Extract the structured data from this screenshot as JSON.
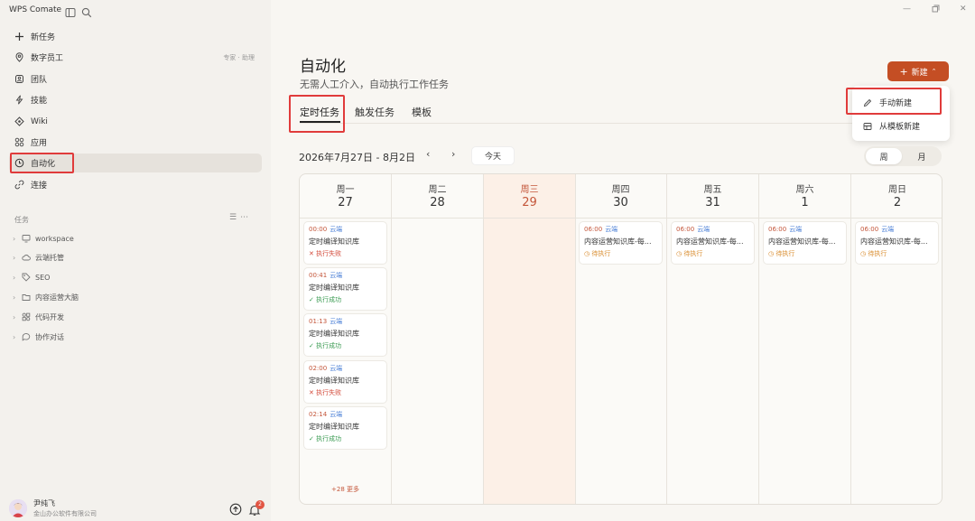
{
  "app": {
    "title": "WPS Comate"
  },
  "sidebar": {
    "nav": [
      {
        "label": "新任务",
        "icon": "plus-icon"
      },
      {
        "label": "数字员工",
        "icon": "location-pin-icon",
        "extra": "专家 · 助理"
      },
      {
        "label": "团队",
        "icon": "team-icon"
      },
      {
        "label": "技能",
        "icon": "bolt-icon"
      },
      {
        "label": "Wiki",
        "icon": "wiki-icon"
      },
      {
        "label": "应用",
        "icon": "apps-grid-icon"
      },
      {
        "label": "自动化",
        "icon": "clock-icon",
        "active": true
      },
      {
        "label": "连接",
        "icon": "link-icon"
      }
    ],
    "section_label": "任务",
    "tree": [
      {
        "label": "workspace",
        "icon": "monitor-icon"
      },
      {
        "label": "云端托管",
        "icon": "cloud-icon"
      },
      {
        "label": "SEO",
        "icon": "tag-icon"
      },
      {
        "label": "内容运营大脑",
        "icon": "folder-icon"
      },
      {
        "label": "代码开发",
        "icon": "code-grid-icon"
      },
      {
        "label": "协作对话",
        "icon": "chat-icon"
      }
    ],
    "user": {
      "name": "尹纯飞",
      "org": "金山办公软件有限公司"
    },
    "notification_count": "2"
  },
  "main": {
    "title": "自动化",
    "subtitle": "无需人工介入，自动执行工作任务",
    "tabs": [
      {
        "label": "定时任务",
        "active": true
      },
      {
        "label": "触发任务"
      },
      {
        "label": "模板"
      }
    ],
    "new_button": "新建",
    "dropdown": [
      {
        "label": "手动新建",
        "icon": "pencil-icon"
      },
      {
        "label": "从模板新建",
        "icon": "template-icon"
      }
    ],
    "range": "2026年7月27日 - 8月2日",
    "today_label": "今天",
    "views": [
      {
        "label": "周",
        "active": true
      },
      {
        "label": "月"
      }
    ]
  },
  "calendar": {
    "days": [
      {
        "name": "周一",
        "num": "27"
      },
      {
        "name": "周二",
        "num": "28"
      },
      {
        "name": "周三",
        "num": "29",
        "today": true
      },
      {
        "name": "周四",
        "num": "30"
      },
      {
        "name": "周五",
        "num": "31"
      },
      {
        "name": "周六",
        "num": "1"
      },
      {
        "name": "周日",
        "num": "2"
      }
    ],
    "monday_tasks": [
      {
        "time": "00:00",
        "tag": "云端",
        "name": "定时编译知识库",
        "status": "执行失败",
        "state": "fail"
      },
      {
        "time": "00:41",
        "tag": "云端",
        "name": "定时编译知识库",
        "status": "执行成功",
        "state": "ok"
      },
      {
        "time": "01:13",
        "tag": "云端",
        "name": "定时编译知识库",
        "status": "执行成功",
        "state": "ok"
      },
      {
        "time": "02:00",
        "tag": "云端",
        "name": "定时编译知识库",
        "status": "执行失败",
        "state": "fail"
      },
      {
        "time": "02:14",
        "tag": "云端",
        "name": "定时编译知识库",
        "status": "执行成功",
        "state": "ok"
      }
    ],
    "more_label": "+28 更多",
    "recurring_task": {
      "time": "06:00",
      "tag": "云端",
      "name": "内容运营知识库-每...",
      "status": "待执行"
    }
  }
}
